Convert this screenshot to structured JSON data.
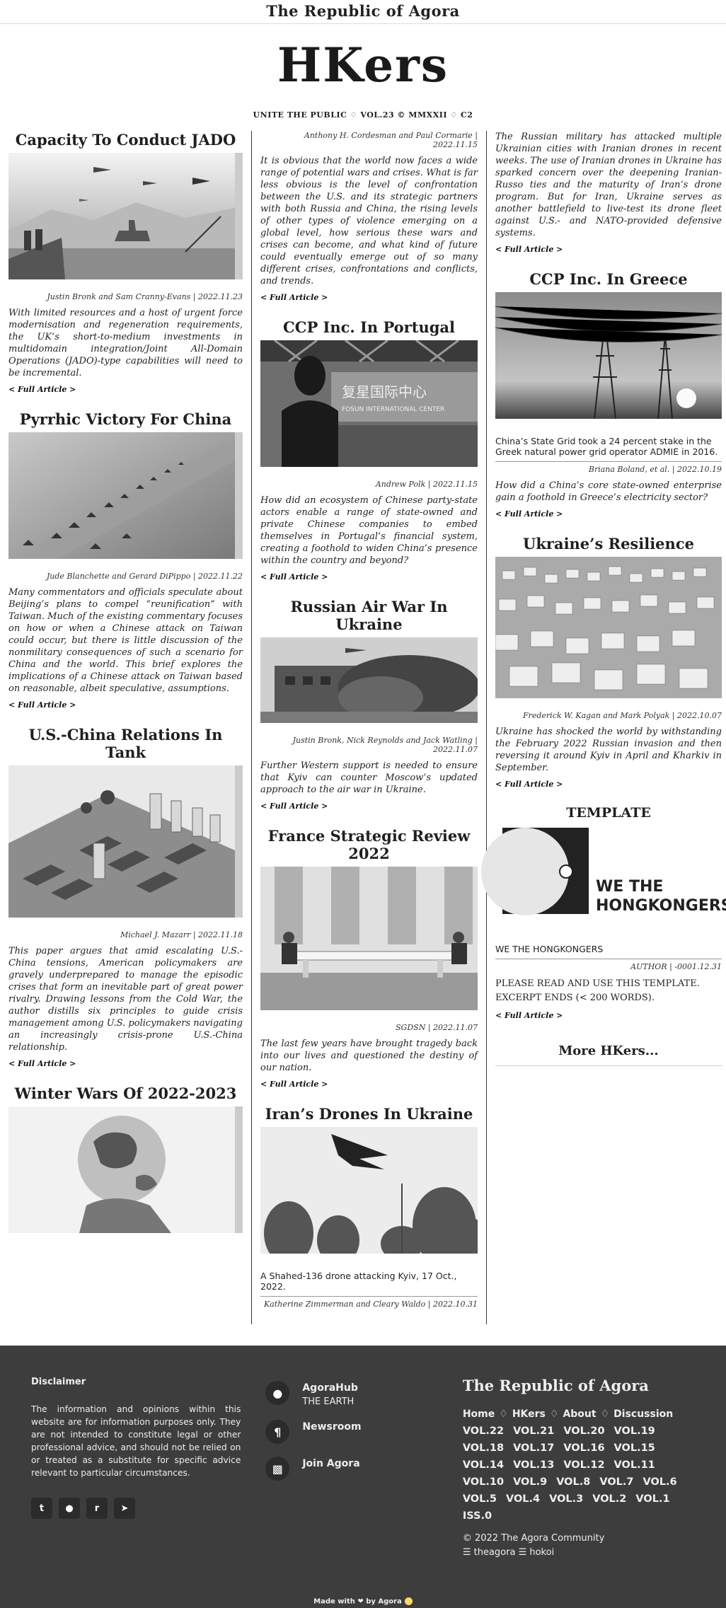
{
  "site": {
    "brand": "The Republic of Agora",
    "logo": "HKers",
    "tagline": "UNITE THE PUBLIC ♢ VOL.23 © MMXXII ♢ C2"
  },
  "col1": [
    {
      "title": "Capacity To Conduct JADO",
      "byline": "Justin Bronk and Sam Cranny-Evans | 2022.11.23",
      "excerpt": "With limited resources and a host of urgent force modernisation and regeneration requirements, the UK’s short-to-medium investments in multidomain integration/Joint All-Domain Operations (JADO)-type capabilities will need to be incremental.",
      "more": "< Full Article >"
    },
    {
      "title": "Pyrrhic Victory For China",
      "byline": "Jude Blanchette and Gerard DiPippo | 2022.11.22",
      "excerpt": "Many commentators and officials speculate about Beijing’s plans to compel “reunification” with Taiwan. Much of the existing commentary focuses on how or when a Chinese attack on Taiwan could occur, but there is little discussion of the nonmilitary consequences of such a scenario for China and the world. This brief explores the implications of a Chinese attack on Taiwan based on reasonable, albeit speculative, assumptions.",
      "more": "< Full Article >"
    },
    {
      "title": "U.S.-China Relations In Tank",
      "byline": "Michael J. Mazarr | 2022.11.18",
      "excerpt": "This paper argues that amid escalating U.S.-China tensions, American policymakers are gravely underprepared to manage the episodic crises that form an inevitable part of great power rivalry. Drawing lessons from the Cold War, the author distills six principles to guide crisis management among U.S. policymakers navigating an increasingly crisis-prone U.S.-China relationship.",
      "more": "< Full Article >"
    },
    {
      "title": "Winter Wars Of 2022-2023"
    }
  ],
  "col2": [
    {
      "byline": "Anthony H. Cordesman and Paul Cormarie | 2022.11.15",
      "excerpt": "It is obvious that the world now faces a wide range of potential wars and crises. What is far less obvious is the level of confrontation between the U.S. and its strategic partners with both Russia and China, the rising levels of other types of violence emerging on a global level, how serious these wars and crises can become, and what kind of future could eventually emerge out of so many different crises, confrontations and conflicts, and trends.",
      "more": "< Full Article >"
    },
    {
      "title": "CCP Inc. In Portugal",
      "sign": "复星国际中心",
      "sign2": "FOSUN INTERNATIONAL CENTER",
      "byline": "Andrew Polk | 2022.11.15",
      "excerpt": "How did an ecosystem of Chinese party-state actors enable a range of state-owned and private Chinese companies to embed themselves in Portugal’s financial system, creating a foothold to widen China’s presence within the country and beyond?",
      "more": "< Full Article >"
    },
    {
      "title": "Russian Air War In Ukraine",
      "byline": "Justin Bronk, Nick Reynolds and Jack Watling | 2022.11.07",
      "excerpt": "Further Western support is needed to ensure that Kyiv can counter Moscow’s updated approach to the air war in Ukraine.",
      "more": "< Full Article >"
    },
    {
      "title": "France Strategic Review 2022",
      "byline": "SGDSN | 2022.11.07",
      "excerpt": "The last few years have brought tragedy back into our lives and questioned the destiny of our nation.",
      "more": "< Full Article >"
    },
    {
      "title": "Iran’s Drones In Ukraine",
      "caption": "A Shahed-136 drone attacking Kyiv, 17 Oct., 2022.",
      "byline": "Katherine Zimmerman and Cleary Waldo | 2022.10.31"
    }
  ],
  "col3": [
    {
      "excerpt": "The Russian military has attacked multiple Ukrainian cities with Iranian drones in recent weeks. The use of Iranian drones in Ukraine has sparked concern over the deepening Iranian-Russo ties and the maturity of Iran’s drone program. But for Iran, Ukraine serves as another battlefield to live-test its drone fleet against U.S.- and NATO-provided defensive systems.",
      "more": "< Full Article >"
    },
    {
      "title": "CCP Inc. In Greece",
      "caption": "China’s State Grid took a 24 percent stake in the Greek natural power grid operator ADMIE in 2016.",
      "byline": "Briana Boland, et al. | 2022.10.19",
      "excerpt": "How did a China’s core state-owned enterprise gain a foothold in Greece’s electricity sector?",
      "more": "< Full Article >"
    },
    {
      "title": "Ukraine’s Resilience",
      "byline": "Frederick W. Kagan and Mark Polyak | 2022.10.07",
      "excerpt": "Ukraine has shocked the world by withstanding the February 2022 Russian invasion and then reversing it around Kyiv in April and Kharkiv in September.",
      "more": "< Full Article >"
    },
    {
      "title": "TEMPLATE",
      "logo_text": "WE THE\nHONGKONGERS",
      "caption": "WE THE HONGKONGERS",
      "byline": "AUTHOR | -0001.12.31",
      "body1": "PLEASE READ AND USE THIS TEMPLATE.",
      "body2": "EXCERPT ENDS (< 200 WORDS).",
      "more": "< Full Article >"
    }
  ],
  "more_hkers": "More HKers...",
  "footer": {
    "disclaimer_title": "Disclaimer",
    "disclaimer_text": "The information and opinions within this website are for information purposes only. They are not intended to constitute legal or other professional advice, and should not be relied on or treated as a substitute for specific advice relevant to particular circumstances.",
    "socials": [
      "twitter-icon",
      "github-icon",
      "reddit-icon",
      "telegram-icon"
    ],
    "links": [
      {
        "label": "AgoraHub",
        "sub": "THE EARTH",
        "icon": "location-pin-icon"
      },
      {
        "label": "Newsroom",
        "sub": "",
        "icon": "paragraph-icon"
      },
      {
        "label": "Join Agora",
        "sub": "",
        "icon": "puzzle-icon"
      }
    ],
    "brand": "The Republic of Agora",
    "nav": [
      "Home",
      "HKers",
      "About",
      "Discussion"
    ],
    "nav_sep": "♢",
    "vols": [
      "VOL.22",
      "VOL.21",
      "VOL.20",
      "VOL.19",
      "VOL.18",
      "VOL.17",
      "VOL.16",
      "VOL.15",
      "VOL.14",
      "VOL.13",
      "VOL.12",
      "VOL.11",
      "VOL.10",
      "VOL.9",
      "VOL.8",
      "VOL.7",
      "VOL.6",
      "VOL.5",
      "VOL.4",
      "VOL.3",
      "VOL.2",
      "VOL.1",
      "ISS.0"
    ],
    "copyright": "© 2022 The Agora Community",
    "handles": "☰ theagora ☰ hokoi",
    "made_with": "Made with ❤ by Agora"
  }
}
